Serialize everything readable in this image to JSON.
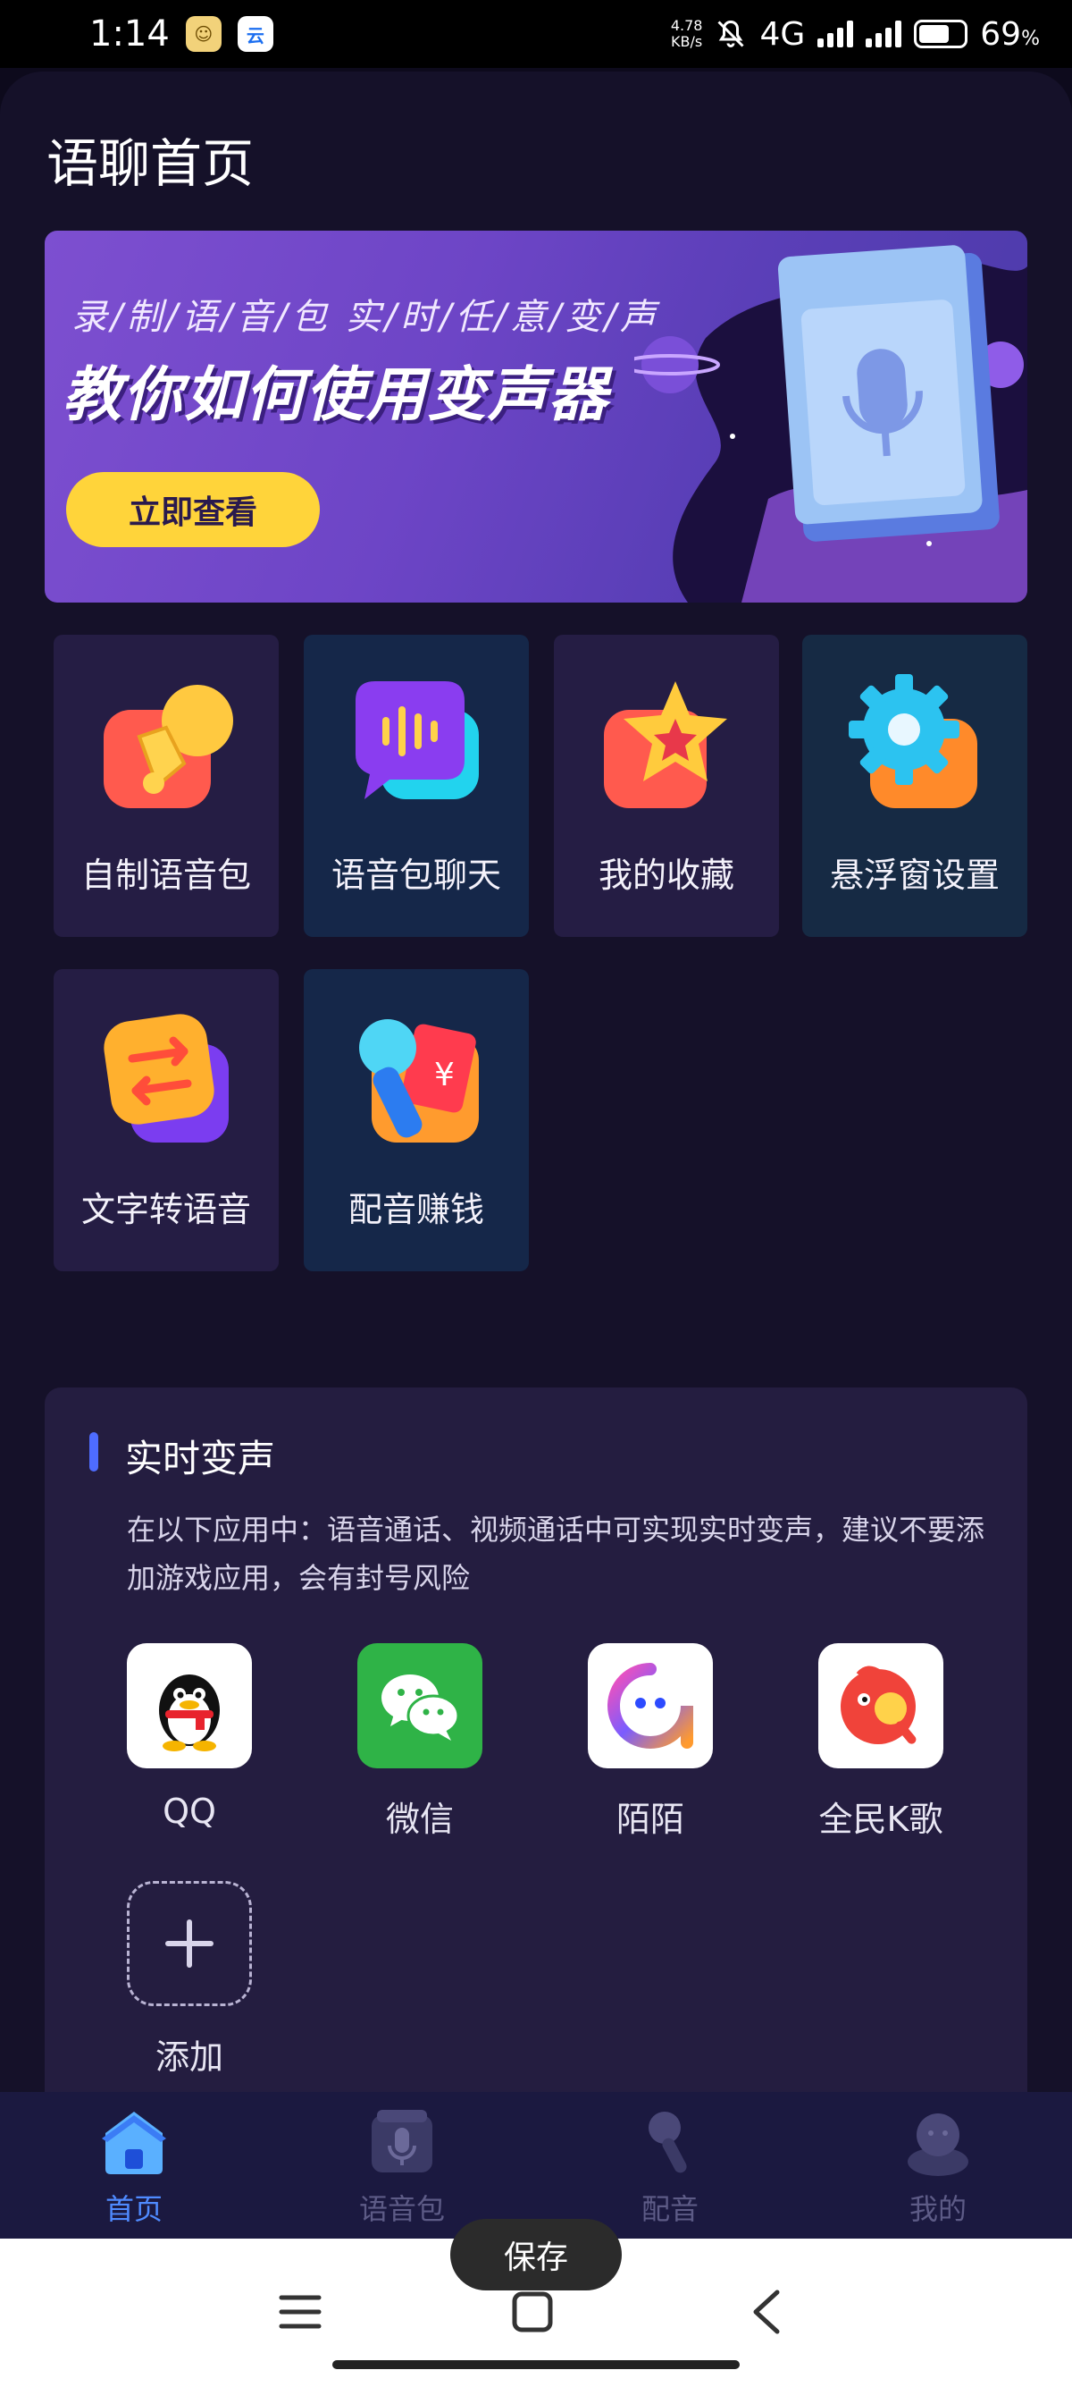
{
  "status_bar": {
    "time": "1:14",
    "net_speed_value": "4.78",
    "net_speed_unit": "KB/s",
    "network": "4G",
    "battery_percent": "69",
    "battery_percent_sign": "%",
    "battery_level": 0.69
  },
  "page": {
    "title": "语聊首页"
  },
  "banner": {
    "subtitle": "录/制/语/音/包     实/时/任/意/变/声",
    "title": "教你如何使用变声器",
    "cta_label": "立即查看"
  },
  "features": [
    {
      "label": "自制语音包",
      "icon": "bell-icon"
    },
    {
      "label": "语音包聊天",
      "icon": "voice-chat-icon"
    },
    {
      "label": "我的收藏",
      "icon": "star-icon"
    },
    {
      "label": "悬浮窗设置",
      "icon": "gear-icon"
    },
    {
      "label": "文字转语音",
      "icon": "text-to-speech-icon"
    },
    {
      "label": "配音赚钱",
      "icon": "microphone-money-icon"
    }
  ],
  "realtime": {
    "title": "实时变声",
    "description": "在以下应用中：语音通话、视频通话中可实现实时变声，建议不要添加游戏应用，会有封号风险",
    "apps": [
      {
        "name": "QQ",
        "icon": "qq-icon"
      },
      {
        "name": "微信",
        "icon": "wechat-icon"
      },
      {
        "name": "陌陌",
        "icon": "momo-icon"
      },
      {
        "name": "全民K歌",
        "icon": "karaoke-icon"
      }
    ],
    "add_label": "添加"
  },
  "bottom_nav": [
    {
      "label": "首页",
      "icon": "home-icon",
      "active": true
    },
    {
      "label": "语音包",
      "icon": "voice-pack-icon",
      "active": false
    },
    {
      "label": "配音",
      "icon": "microphone-icon",
      "active": false
    },
    {
      "label": "我的",
      "icon": "profile-icon",
      "active": false
    }
  ],
  "toast": {
    "text": "保存"
  },
  "colors": {
    "background": "#151129",
    "accent_blue": "#4f8bff",
    "cta_yellow": "#ffd43a",
    "wechat_green": "#2fb347"
  }
}
